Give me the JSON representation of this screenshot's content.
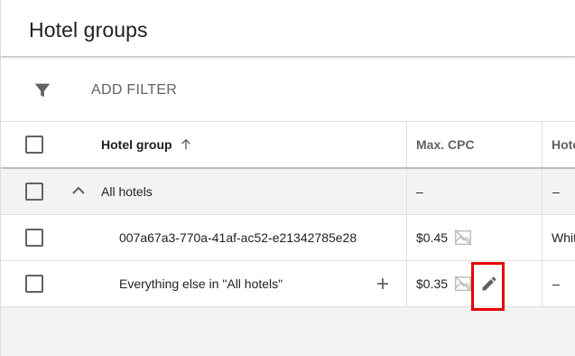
{
  "page": {
    "title": "Hotel groups"
  },
  "filter_bar": {
    "icon": "filter-icon",
    "add_filter_label": "ADD FILTER"
  },
  "table": {
    "columns": {
      "hotel_group": "Hotel group",
      "max_cpc": "Max. CPC",
      "third": "Hote"
    },
    "sort_icon": "arrow-up-icon",
    "rows": [
      {
        "name": "All hotels",
        "max_cpc": "–",
        "third": "–",
        "expand_icon": "chevron-up-icon"
      },
      {
        "name": "007a67a3-770a-41af-ac52-e21342785e28",
        "max_cpc": "$0.45",
        "third": "Whit",
        "cpc_icon": "no-image-icon"
      },
      {
        "name": "Everything else in \"All hotels\"",
        "max_cpc": "$0.35",
        "third": "–",
        "cpc_icon": "no-image-icon",
        "edit_icon": "pencil-icon",
        "add_icon": "plus-icon"
      }
    ]
  },
  "colors": {
    "highlight": "#e60000",
    "group_row_bg": "#f1f3f4"
  }
}
